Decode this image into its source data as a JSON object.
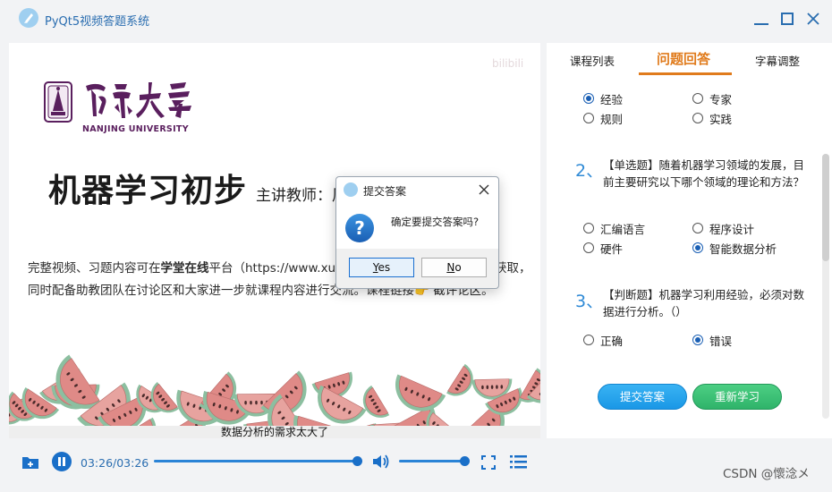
{
  "window": {
    "title": "PyQt5视频答题系统",
    "controls": [
      "minimize-icon",
      "maximize-icon",
      "close-icon"
    ]
  },
  "video": {
    "slide": {
      "university_en": "NANJING UNIVERSITY",
      "course_title": "机器学习初步",
      "teacher_label": "主讲教师：周",
      "body_line1_pre": "完整视频、习题内容可在",
      "body_line1_bold": "学堂在线",
      "body_line1_post": "平台（https://www.xuetang",
      "body_line1_tail": "获取，",
      "body_line2": "同时配备助教团队在讨论区和大家进一步就课程内容进行交流。",
      "body_line2_tail": "课程链接👉 截评论区。",
      "watermark": "bilibili"
    },
    "subtitle": "数据分析的需求太大了"
  },
  "tabs": {
    "courses": "课程列表",
    "qa": "问题回答",
    "subs": "字幕调整",
    "active": "问题回答"
  },
  "questions": {
    "q1": {
      "options": [
        "经验",
        "专家",
        "规则",
        "实践"
      ],
      "selected": "经验"
    },
    "q2": {
      "number": "2、",
      "text": "【单选题】随着机器学习领域的发展，目前主要研究以下哪个领域的理论和方法？",
      "options": [
        "汇编语言",
        "程序设计",
        "硬件",
        "智能数据分析"
      ],
      "selected": "智能数据分析"
    },
    "q3": {
      "number": "3、",
      "text": "【判断题】机器学习利用经验，必须对数据进行分析。（）",
      "options": [
        "正确",
        "错误"
      ],
      "selected": "错误"
    }
  },
  "actions": {
    "submit": "提交答案",
    "relearn": "重新学习"
  },
  "player": {
    "time": "03:26/03:26",
    "progress": 1.0,
    "volume": 0.9
  },
  "dialog": {
    "title": "提交答案",
    "message": "确定要提交答案吗?",
    "yes_pre": "",
    "yes_u": "Y",
    "yes_post": "es",
    "no_u": "N",
    "no_post": "o"
  },
  "footer_watermark": "CSDN @懷淰メ",
  "colors": {
    "accent": "#e07b1c",
    "link_blue": "#2a6db0",
    "submit": "#1a97e6",
    "relearn": "#2fb36a"
  }
}
